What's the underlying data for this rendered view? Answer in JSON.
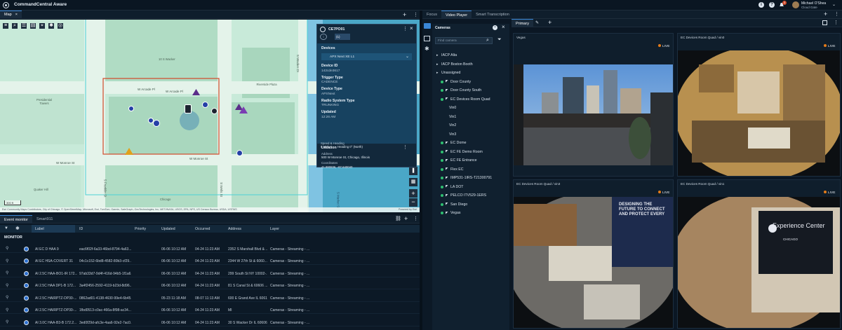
{
  "app": {
    "title": "CommandCentral Aware",
    "user_name": "Michael O'Shea",
    "user_role": "Cloud Gate",
    "notification_count": "3"
  },
  "left_panel": {
    "tab": "Map"
  },
  "map": {
    "streets": [
      "W Arcade Pl",
      "W Arcade Pl",
      "W Monroe St",
      "W Monroe St",
      "S Franklin St",
      "S Wells St",
      "S Wacker Dr",
      "S Market St"
    ],
    "building_labels": [
      "Presidential Towers",
      "10 S Wacker",
      "Riverside Plaza",
      "Quaker Hill",
      "Chicago"
    ],
    "attribution": "Esri Community Maps Contributors, City of Chicago, © OpenStreetMap, Microsoft, Esri, TomTom, Garmin, SafeGraph, GeoTechnologies, Inc, METI/NASA, USGS, EPA, NPS, US Census Bureau, USDA, USFWS",
    "powered_by": "Powered by Esri",
    "scale": "300 ft"
  },
  "card": {
    "title": "CE7PO01",
    "tab_label": "(1)",
    "devices_heading": "Devices",
    "device_name": "APX Next XE L1",
    "fields": [
      {
        "label": "Device ID",
        "value": "142cde3617"
      },
      {
        "label": "Trigger Type",
        "value": "CADENCE"
      },
      {
        "label": "Device Type",
        "value": "APXNext"
      },
      {
        "label": "Radio System Type",
        "value": "TRUNKING"
      },
      {
        "label": "Updated",
        "value": "12:26 AM"
      }
    ],
    "location_heading": "Location",
    "address_label": "Address",
    "address": "500 W Monroe St, Chicago, Illinois",
    "coordinates_label": "Coordinates",
    "coordinates": "41.880836, -87.640040",
    "speed_label": "Speed & Heading",
    "speed": "0 Mph",
    "heading": "Heading 0° (North)"
  },
  "events": {
    "tabs": [
      "Event monitor",
      "Smart911"
    ],
    "section": "MONITOR",
    "columns": [
      "Label",
      "ID",
      "Priority",
      "Updated",
      "Occurred",
      "Address",
      "Layer"
    ],
    "rows": [
      {
        "label": "AI EC D HAA 9",
        "id": "eac6f02f-6a33-46bd-8794-4a63...",
        "priority": "",
        "updated": "06-06 10:12 AM",
        "occurred": "04-24 11:23 AM",
        "address": "2352 S Marshall Blvd & ...",
        "layer": "Cameras - Streaming - ..."
      },
      {
        "label": "AI EC HSA-COVERT 31",
        "id": "04c1c152-6bd8-4582-80b3-cf29...",
        "priority": "",
        "updated": "06-06 10:12 AM",
        "occurred": "04-24 11:23 AM",
        "address": "2344 W 27th St & 6060...",
        "layer": "Cameras - Streaming - ..."
      },
      {
        "label": "AI 2.5C HAA-BO1-IR 172...",
        "id": "97ab33d7-9d4f-416d-94b5-1f1a6...",
        "priority": "",
        "updated": "06-06 10:12 AM",
        "occurred": "04-24 11:23 AM",
        "address": "299 South St NY 10002-...",
        "layer": "Cameras - Streaming - ..."
      },
      {
        "label": "AI 2.5C HAA DP1-B 172...",
        "id": "3a4f2456-2592-4119-b23d-8d96...",
        "priority": "",
        "updated": "06-06 10:12 AM",
        "occurred": "04-24 11:23 AM",
        "address": "81 S Canal St & 60606 ...",
        "layer": "Cameras - Streaming - ..."
      },
      {
        "label": "AI 2.5C HAIRPTZ-DP30-...",
        "id": "0862ad01-4138-4630-99e4-6b45...",
        "priority": "",
        "updated": "05-23 11:18 AM",
        "occurred": "08-07 11:13 AM",
        "address": "600 E Grand Ave IL 6061...",
        "layer": "Cameras - Streaming - ..."
      },
      {
        "label": "AI 2.5C HAIRPTZ-DP30-...",
        "id": "1fbd0513-c0ac-466a-8f98-ac34...",
        "priority": "",
        "updated": "06-06 10:12 AM",
        "occurred": "04-24 11:23 AM",
        "address": "MI",
        "layer": "Cameras - Streaming - ..."
      },
      {
        "label": "AI 3.0C HAA-B3-B 172.2...",
        "id": "3ed0f29d-afc3e-4aa6-92e2-7ac0...",
        "priority": "",
        "updated": "06-06 10:12 AM",
        "occurred": "04-24 11:23 AM",
        "address": "30 S Wacker Dr IL 60606...",
        "layer": "Cameras - Streaming - ..."
      },
      {
        "label": "AI 3.0C HSA-BO2-IR_Na...",
        "id": "0c2f1258-a577-4118-9753-4ae41...",
        "priority": "",
        "updated": "06-23 11:18 AM",
        "occurred": "08-07 11:13 AM",
        "address": "600 E Grand Ave IL 6061...",
        "layer": "Cameras - Streaming - ..."
      }
    ]
  },
  "right_panel": {
    "tabs": [
      "Focus",
      "Video Player",
      "Smart Transcription"
    ],
    "active_tab": "Video Player",
    "cameras_heading": "Cameras",
    "search_placeholder": "Find camera",
    "tree": [
      {
        "label": "IACP Alta",
        "level": 1,
        "dot": false
      },
      {
        "label": "IACP Boston Booth",
        "level": 1,
        "dot": false
      },
      {
        "label": "Unassigned",
        "level": 1,
        "dot": false
      },
      {
        "label": "Door County",
        "level": 2,
        "dot": true
      },
      {
        "label": "Door County South",
        "level": 2,
        "dot": true
      },
      {
        "label": "EC Devices Room Quad",
        "level": 2,
        "dot": true
      },
      {
        "label": "Vin0",
        "level": 3,
        "dot": false
      },
      {
        "label": "Vin1",
        "level": 3,
        "dot": false
      },
      {
        "label": "Vin2",
        "level": 3,
        "dot": false
      },
      {
        "label": "Vin3",
        "level": 3,
        "dot": false
      },
      {
        "label": "EC Dome",
        "level": 2,
        "dot": true
      },
      {
        "label": "EC FE Demo Room",
        "level": 2,
        "dot": true
      },
      {
        "label": "EC FE Entrance",
        "level": 2,
        "dot": true
      },
      {
        "label": "Flex EC",
        "level": 2,
        "dot": true
      },
      {
        "label": "IMP531-1IRS-T21300791",
        "level": 2,
        "dot": true
      },
      {
        "label": "LA DOT",
        "level": 2,
        "dot": true
      },
      {
        "label": "PELCO ITV529-1ERS",
        "level": 2,
        "dot": true
      },
      {
        "label": "San Diego",
        "level": 2,
        "dot": true
      },
      {
        "label": "Vegas",
        "level": 2,
        "dot": true
      }
    ],
    "player_tab": "Primary",
    "live_label": "LIVE",
    "tiles": [
      {
        "title": "Vegas"
      },
      {
        "title": "EC Devices Room Quad / vin0"
      },
      {
        "title": "EC Devices Room Quad / vin3"
      },
      {
        "title": "EC Devices Room Quad / vin1"
      }
    ],
    "tile_texts": {
      "center_text": "DESIGNING THE FUTURE TO CONNECT AND PROTECT EVERY",
      "exp_title": "Experience Center",
      "exp_city": "CHICAGO"
    }
  },
  "colors": {
    "accent": "#3a87d6",
    "live": "#e37b19",
    "map_bg": "#bfe3d3",
    "selection": "#d24a2a"
  }
}
